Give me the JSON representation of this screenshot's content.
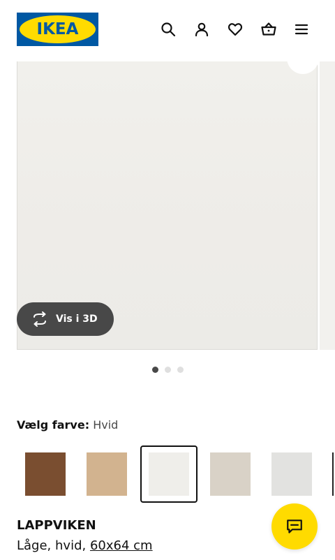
{
  "header": {
    "logo_text": "IKEA",
    "icons": [
      "search-icon",
      "user-icon",
      "heart-icon",
      "basket-icon",
      "menu-icon"
    ]
  },
  "gallery": {
    "view_3d_label": "Vis i 3D",
    "page_count": 3,
    "active_page": 1
  },
  "color_picker": {
    "label": "Vælg farve:",
    "selected_value": "Hvid",
    "swatches": [
      {
        "color": "#7a4e30",
        "selected": false
      },
      {
        "color": "#d2b38f",
        "selected": false
      },
      {
        "color": "#efeeea",
        "selected": true
      },
      {
        "color": "#d9d2c7",
        "selected": false
      },
      {
        "color": "#e2e2e0",
        "selected": false
      }
    ]
  },
  "product": {
    "name": "LAPPVIKEN",
    "description": "Låge, hvid,",
    "size_link": "60x64 cm"
  },
  "colors": {
    "ikea_blue": "#0058a3",
    "ikea_yellow": "#ffdb00",
    "dark_button": "#484848"
  }
}
